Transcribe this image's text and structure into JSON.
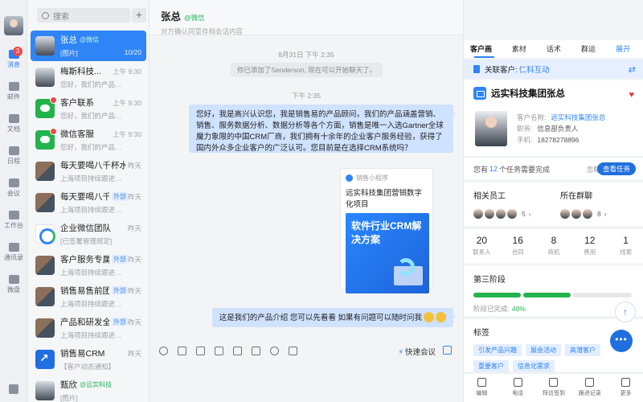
{
  "rail": {
    "items": [
      {
        "label": "消息",
        "badge": "3",
        "icon": "message-icon"
      },
      {
        "label": "邮件",
        "icon": "mail-icon"
      },
      {
        "label": "文档",
        "icon": "document-icon"
      },
      {
        "label": "日程",
        "icon": "calendar-icon"
      },
      {
        "label": "会议",
        "icon": "meeting-icon"
      },
      {
        "label": "工作台",
        "icon": "workbench-icon"
      },
      {
        "label": "通讯录",
        "icon": "contacts-icon"
      },
      {
        "label": "微盘",
        "icon": "drive-icon"
      }
    ]
  },
  "convlist": {
    "search_placeholder": "搜索",
    "add_label": "+",
    "items": [
      {
        "name": "张总",
        "tag": "@微信",
        "tag_type": "wx",
        "preview": "[图片]",
        "time": "",
        "count": "10/20",
        "avatar": "person"
      },
      {
        "name": "梅斯科技...",
        "tag": "",
        "preview": "您好，我们的产品优...",
        "time": "上午 9:30",
        "avatar": "person"
      },
      {
        "name": "客户联系",
        "tag": "",
        "preview": "您好，我们的产品优...",
        "time": "上午 9:30",
        "avatar": "green",
        "dot": true
      },
      {
        "name": "微信客服",
        "tag": "",
        "preview": "您好，我们的产品优...",
        "time": "上午 9:30",
        "avatar": "green",
        "dot": true
      },
      {
        "name": "每天要喝八千杯水",
        "tag": "",
        "preview": "上海项目持续跟进中...",
        "time": "昨天",
        "avatar": "group"
      },
      {
        "name": "每天要喝八千杯水",
        "tag": "外部",
        "tag_type": "ext",
        "preview": "上海项目持续跟进中...",
        "time": "昨天",
        "avatar": "group"
      },
      {
        "name": "企业微信团队",
        "tag": "",
        "preview": "[已签署管理规定]",
        "time": "昨天",
        "avatar": "blue"
      },
      {
        "name": "客户服务专属小组",
        "tag": "外部",
        "tag_type": "ext",
        "preview": "上海项目持续跟进中...",
        "time": "昨天",
        "avatar": "group"
      },
      {
        "name": "销售易售前团队",
        "tag": "外部",
        "tag_type": "ext",
        "preview": "上海项目持续跟进中...",
        "time": "昨天",
        "avatar": "group"
      },
      {
        "name": "产品和研发全员",
        "tag": "外部",
        "tag_type": "ext",
        "preview": "上海项目持续跟进中...",
        "time": "昨天",
        "avatar": "group"
      },
      {
        "name": "销售易CRM",
        "tag": "",
        "preview": "【客户动态通知】",
        "time": "昨天",
        "avatar": "crm"
      },
      {
        "name": "甄欣",
        "tag": "@远实科技",
        "tag_type": "wx",
        "preview": "[图片]",
        "time": "",
        "avatar": "person"
      }
    ]
  },
  "chat": {
    "title": "张总",
    "title_tag": "@微信",
    "subtitle": "对方确认同意存档会话内容",
    "time1": "8月31日 下午 2:35",
    "system_msg": "你已添加了Senderson, 现在可以开始聊天了。",
    "time2": "下午 2:35",
    "message1": "您好，我是高兴认识您，我是销售易的产品顾问，我们的产品涵盖营销、销售、服务数据分析、数据分析等各个方面，销售是唯一入选Gartner全球魔力象限的中国CRM厂商，我们拥有十余年的企业客户服务经验，获得了国内外众多企业客户的广泛认可。您目前是在选择CRM系统吗？",
    "card": {
      "source": "销售小程序",
      "title": "远实科技集团营销数字化项目",
      "image_text": "软件行业CRM解决方案"
    },
    "message2": "这是我们的产品介绍 您可以先看看 如果有问题可以随时问我",
    "toolbar": {
      "meeting_label": "快速会议"
    }
  },
  "right": {
    "tabs": [
      "客户画像",
      "素材库",
      "话术库",
      "群运营"
    ],
    "tabs_more": "展开",
    "related_label": "关联客户:",
    "related_value": "仁科互动",
    "company": "远实科技集团张总",
    "fields": [
      {
        "k": "客户名称:",
        "v": "远实科技集团张总",
        "link": true
      },
      {
        "k": "职务:",
        "v": "信息部负责人"
      },
      {
        "k": "手机:",
        "v": "18278278896"
      }
    ],
    "tasks_pre": "您有",
    "tasks_count": "12",
    "tasks_post": "个任务需要完成",
    "tasks_ignore": "忽略",
    "tasks_view": "查看任务",
    "related_staff": "相关员工",
    "related_staff_count": "5",
    "groups": "所在群聊",
    "groups_count": "8",
    "stats": [
      {
        "num": "20",
        "lbl": "联系人"
      },
      {
        "num": "16",
        "lbl": "合同"
      },
      {
        "num": "8",
        "lbl": "商机"
      },
      {
        "num": "12",
        "lbl": "费用"
      },
      {
        "num": "1",
        "lbl": "线索"
      }
    ],
    "stage": "第三阶段",
    "stage_done_label": "阶段已完成:",
    "stage_done_value": "40%",
    "labels_title": "标签",
    "labels": [
      "引发产品兴趣",
      "展会活动",
      "高潜客户",
      "重要客户",
      "信息化需求"
    ],
    "bottom": [
      {
        "label": "编辑",
        "icon": "edit-icon"
      },
      {
        "label": "电话",
        "icon": "phone-icon"
      },
      {
        "label": "拜访签到",
        "icon": "checkin-icon"
      },
      {
        "label": "跟进记录",
        "icon": "followup-icon"
      },
      {
        "label": "更多",
        "icon": "more-icon"
      }
    ]
  },
  "colors": {
    "accent": "#2f85f5",
    "outgoing_bubble": "#cfe2ff",
    "success": "#22b34d"
  }
}
